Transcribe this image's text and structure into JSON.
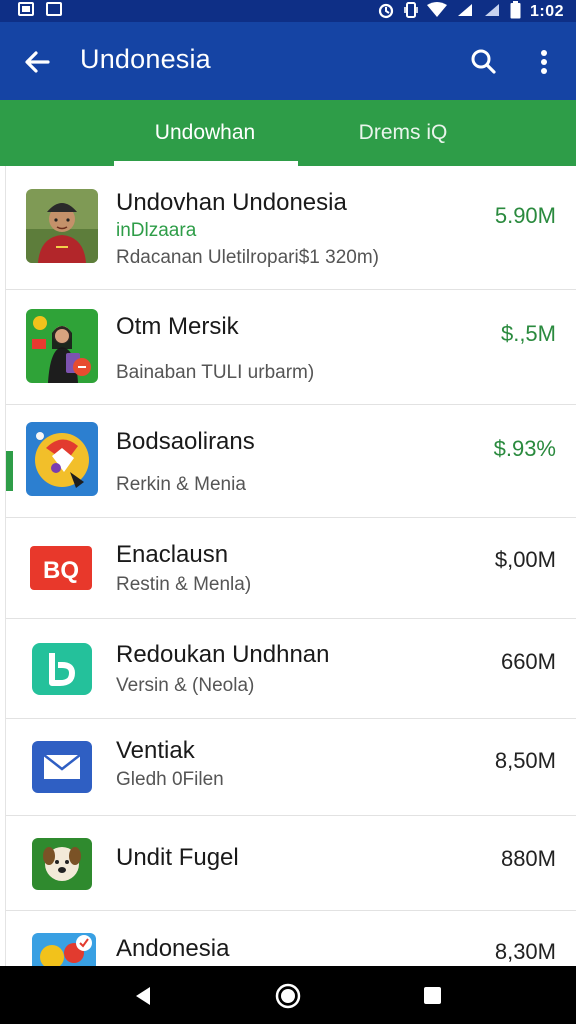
{
  "status_bar": {
    "time": "1:02",
    "icons": [
      "notification-icon",
      "notification-icon",
      "alarm-icon",
      "vibrate-icon",
      "wifi-icon",
      "signal-icon",
      "battery-icon"
    ]
  },
  "app_bar": {
    "title": "Undonesia",
    "back_icon": "arrow-left-icon",
    "search_icon": "search-icon",
    "more_icon": "more-vert-icon"
  },
  "tabs": [
    {
      "label": "Undowhan",
      "selected": true
    },
    {
      "label": "Drems iQ",
      "selected": false
    }
  ],
  "apps": [
    {
      "name": "Undovhan Undonesia",
      "tagline": "inDlzaara",
      "sub": "Rdacanan Uletilropari$1 320m)",
      "size": "5.90M",
      "size_green": true
    },
    {
      "name": "Otm Mersik",
      "tagline": "",
      "sub": "Bainaban TULI urbarm)",
      "size": "$.,5M",
      "size_green": true
    },
    {
      "name": "Bodsaolirans",
      "tagline": "",
      "sub": "Rerkin & Menia",
      "size": "$.93%",
      "size_green": true
    },
    {
      "name": "Enaclausn",
      "tagline": "",
      "sub": "Restin & Menla)",
      "size": "$,00M",
      "size_green": false,
      "icon_text": "BQ"
    },
    {
      "name": "Redoukan Undhnan",
      "tagline": "",
      "sub": "Versin & (Neola)",
      "size": "660M",
      "size_green": false
    },
    {
      "name": "Ventiak",
      "tagline": "",
      "sub": "Gledh 0Filen",
      "size": "8,50M",
      "size_green": false
    },
    {
      "name": "Undit Fugel",
      "tagline": "",
      "sub": "",
      "size": "880M",
      "size_green": false
    },
    {
      "name": "Andonesia",
      "tagline": "",
      "sub": "",
      "size": "8,30M",
      "size_green": false
    }
  ],
  "nav_bar": {
    "back_icon": "nav-back-icon",
    "home_icon": "nav-home-icon",
    "recents_icon": "nav-recents-icon"
  },
  "colors": {
    "status_bar": "#0e2f86",
    "app_bar": "#1544a4",
    "tab_bar": "#2e9d48",
    "accent_green": "#2a8a3e"
  }
}
